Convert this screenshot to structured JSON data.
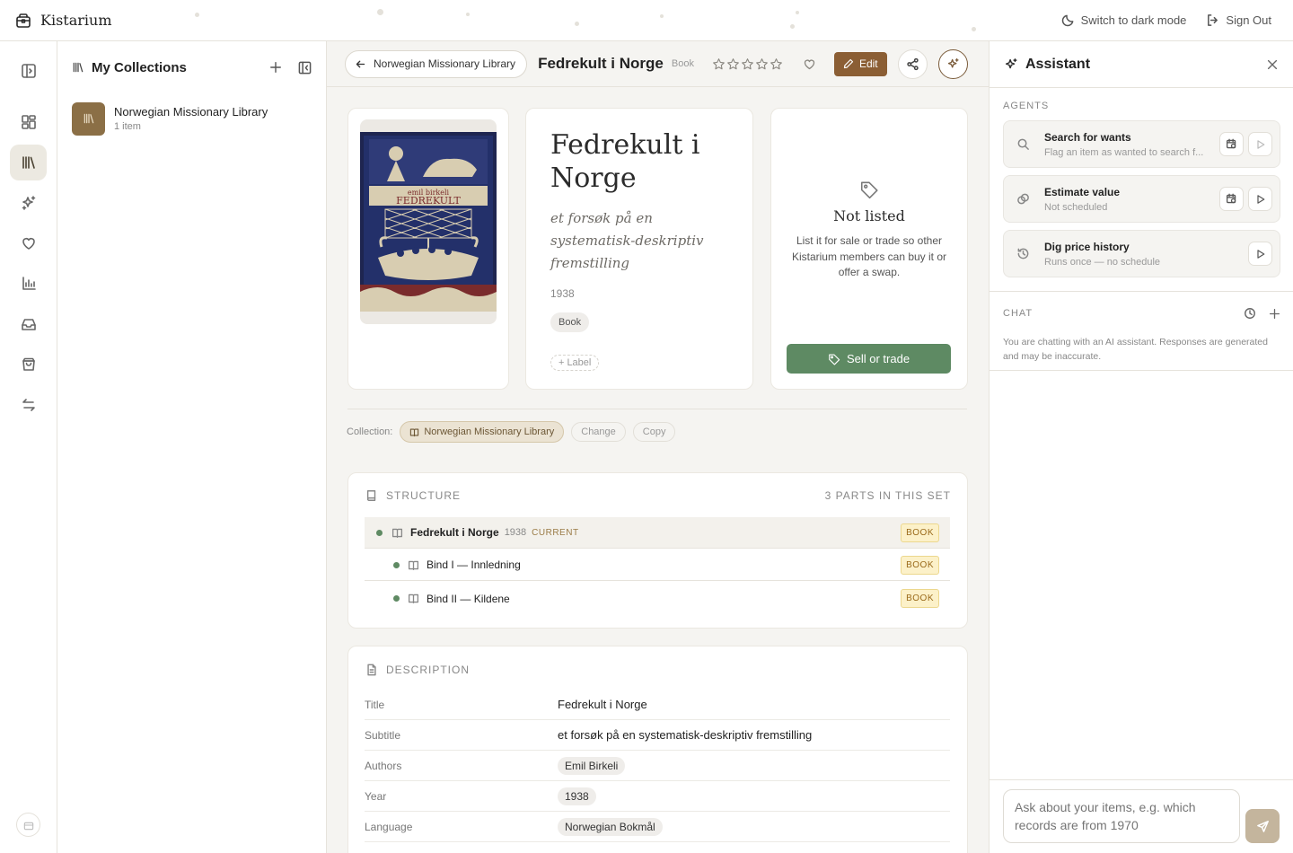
{
  "app": {
    "name": "Kistarium"
  },
  "topbar": {
    "dark_mode": "Switch to dark mode",
    "sign_out": "Sign Out"
  },
  "collections": {
    "title": "My Collections",
    "items": [
      {
        "name": "Norwegian Missionary Library",
        "count": "1 item"
      }
    ]
  },
  "item_header": {
    "back_label": "Norwegian Missionary Library",
    "title": "Fedrekult i Norge",
    "type": "Book",
    "rating": 0,
    "rating_max": 5,
    "edit_label": "Edit"
  },
  "book": {
    "title": "Fedrekult i Norge",
    "subtitle": "et forsøk på en systematisk-deskriptiv fremstilling",
    "year": "1938",
    "type_chip": "Book",
    "label_button": "Label"
  },
  "listing": {
    "title": "Not listed",
    "description": "List it for sale or trade so other Kistarium members can buy it or offer a swap.",
    "button": "Sell or trade"
  },
  "collection_row": {
    "label": "Collection:",
    "value": "Norwegian Missionary Library",
    "change": "Change",
    "copy": "Copy"
  },
  "structure": {
    "heading": "STRUCTURE",
    "count": "3 PARTS IN THIS SET",
    "rows": [
      {
        "title": "Fedrekult i Norge",
        "year": "1938",
        "current": "CURRENT",
        "badge": "BOOK"
      },
      {
        "title": "Bind I — Innledning",
        "badge": "BOOK"
      },
      {
        "title": "Bind II — Kildene",
        "badge": "BOOK"
      }
    ]
  },
  "description": {
    "heading": "DESCRIPTION",
    "rows": [
      {
        "key": "Title",
        "value": "Fedrekult i Norge"
      },
      {
        "key": "Subtitle",
        "value": "et forsøk på en systematisk-deskriptiv fremstilling"
      },
      {
        "key": "Authors",
        "value": "Emil Birkeli"
      },
      {
        "key": "Year",
        "value": "1938"
      },
      {
        "key": "Language",
        "value": "Norwegian Bokmål"
      }
    ]
  },
  "assistant": {
    "title": "Assistant",
    "agents_label": "AGENTS",
    "agents": [
      {
        "name": "Search for wants",
        "sub": "Flag an item as wanted to search f..."
      },
      {
        "name": "Estimate value",
        "sub": "Not scheduled"
      },
      {
        "name": "Dig price history",
        "sub": "Runs once — no schedule"
      }
    ],
    "chat_label": "CHAT",
    "chat_note": "You are chatting with an AI assistant. Responses are generated and may be inaccurate.",
    "input_placeholder": "Ask about your items, e.g. which records are from 1970"
  },
  "colors": {
    "accent": "#8b5e34",
    "success": "#5e8a63",
    "badge": "#fcf1c9"
  }
}
